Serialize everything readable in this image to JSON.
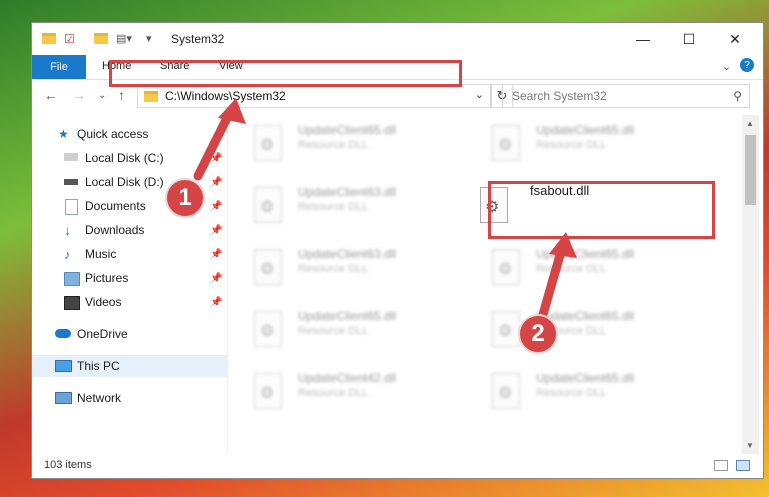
{
  "window": {
    "title": "System32"
  },
  "ribbon": {
    "tabs": [
      "File",
      "Home",
      "Share",
      "View"
    ]
  },
  "address": {
    "path": "C:\\Windows\\System32"
  },
  "search": {
    "placeholder": "Search System32"
  },
  "sidebar": {
    "items": [
      {
        "label": "Quick access",
        "icon": "star-icon",
        "pinned": false
      },
      {
        "label": "Local Disk (C:)",
        "icon": "drive-icon",
        "pinned": true
      },
      {
        "label": "Local Disk (D:)",
        "icon": "drive-icon",
        "pinned": true
      },
      {
        "label": "Documents",
        "icon": "documents-icon",
        "pinned": true
      },
      {
        "label": "Downloads",
        "icon": "downloads-icon",
        "pinned": true
      },
      {
        "label": "Music",
        "icon": "music-icon",
        "pinned": true
      },
      {
        "label": "Pictures",
        "icon": "pictures-icon",
        "pinned": true
      },
      {
        "label": "Videos",
        "icon": "videos-icon",
        "pinned": true
      },
      {
        "label": "OneDrive",
        "icon": "cloud-icon",
        "pinned": false
      },
      {
        "label": "This PC",
        "icon": "pc-icon",
        "pinned": false,
        "selected": true
      },
      {
        "label": "Network",
        "icon": "network-icon",
        "pinned": false
      }
    ]
  },
  "files": [
    {
      "name": "UpdateClient65.dll",
      "type": "Resource DLL"
    },
    {
      "name": "UpdateClient65.dll",
      "type": "Resource DLL"
    },
    {
      "name": "UpdateClient63.dll",
      "type": "Resource DLL"
    },
    {
      "name": "fsabout.dll",
      "type": ""
    },
    {
      "name": "UpdateClient63.dll",
      "type": "Resource DLL"
    },
    {
      "name": "UpdateClient65.dll",
      "type": "Resource DLL"
    },
    {
      "name": "UpdateClient65.dll",
      "type": "Resource DLL"
    },
    {
      "name": "UpdateClient65.dll",
      "type": "Resource DLL"
    },
    {
      "name": "UpdateClient42.dll",
      "type": "Resource DLL"
    },
    {
      "name": "UpdateClient65.dll",
      "type": "Resource DLL"
    }
  ],
  "callouts": [
    "1",
    "2"
  ],
  "status": {
    "count": "103 items"
  },
  "colors": {
    "accent": "#1979ca",
    "callout": "#d64545"
  }
}
